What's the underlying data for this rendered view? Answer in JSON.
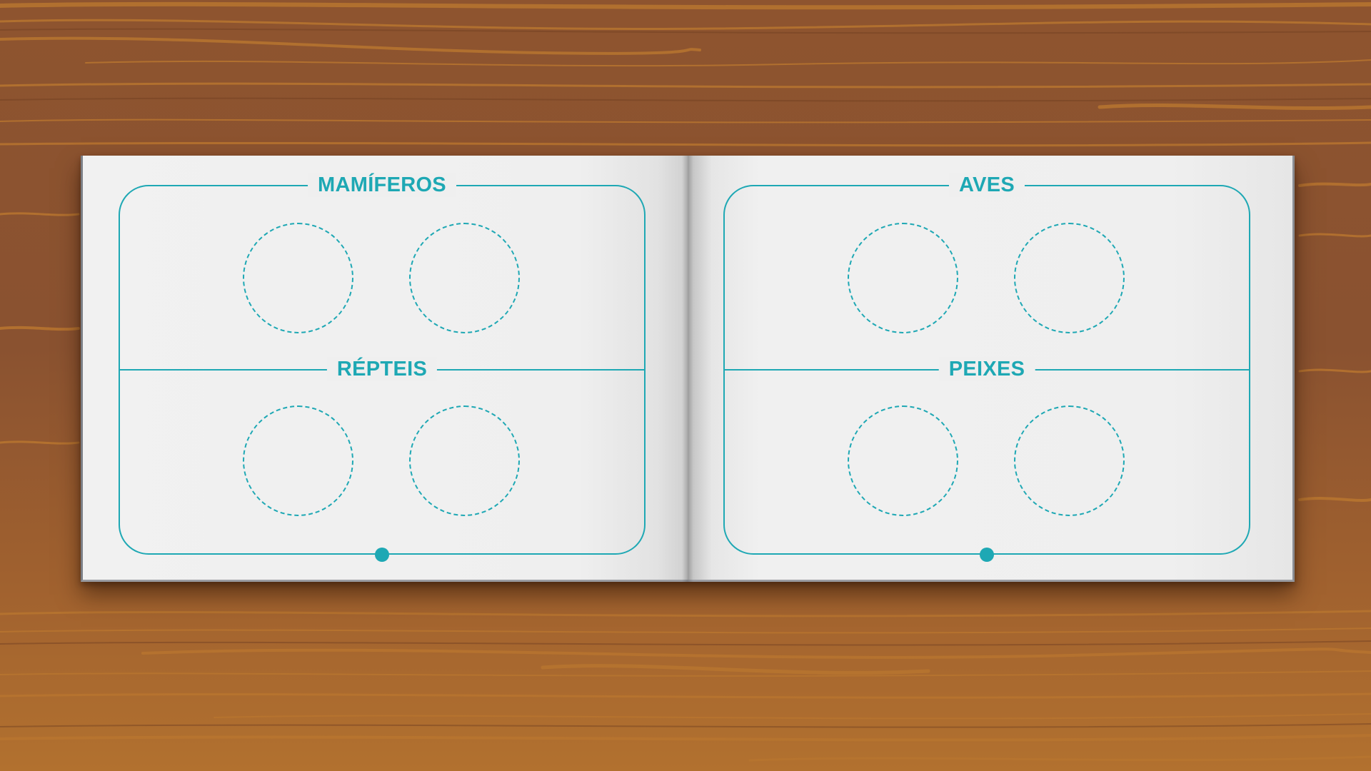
{
  "scene": {
    "background": "wood-table",
    "wood_colors": [
      "#8f5530",
      "#b06d33",
      "#c78a3c"
    ],
    "accent_color": "#1ea8b4",
    "page_color": "#efefef"
  },
  "book": {
    "left_page": {
      "sections": [
        {
          "title": "MAMÍFEROS",
          "slots": 2
        },
        {
          "title": "RÉPTEIS",
          "slots": 2
        }
      ]
    },
    "right_page": {
      "sections": [
        {
          "title": "AVES",
          "slots": 2
        },
        {
          "title": "PEIXES",
          "slots": 2
        }
      ]
    }
  }
}
